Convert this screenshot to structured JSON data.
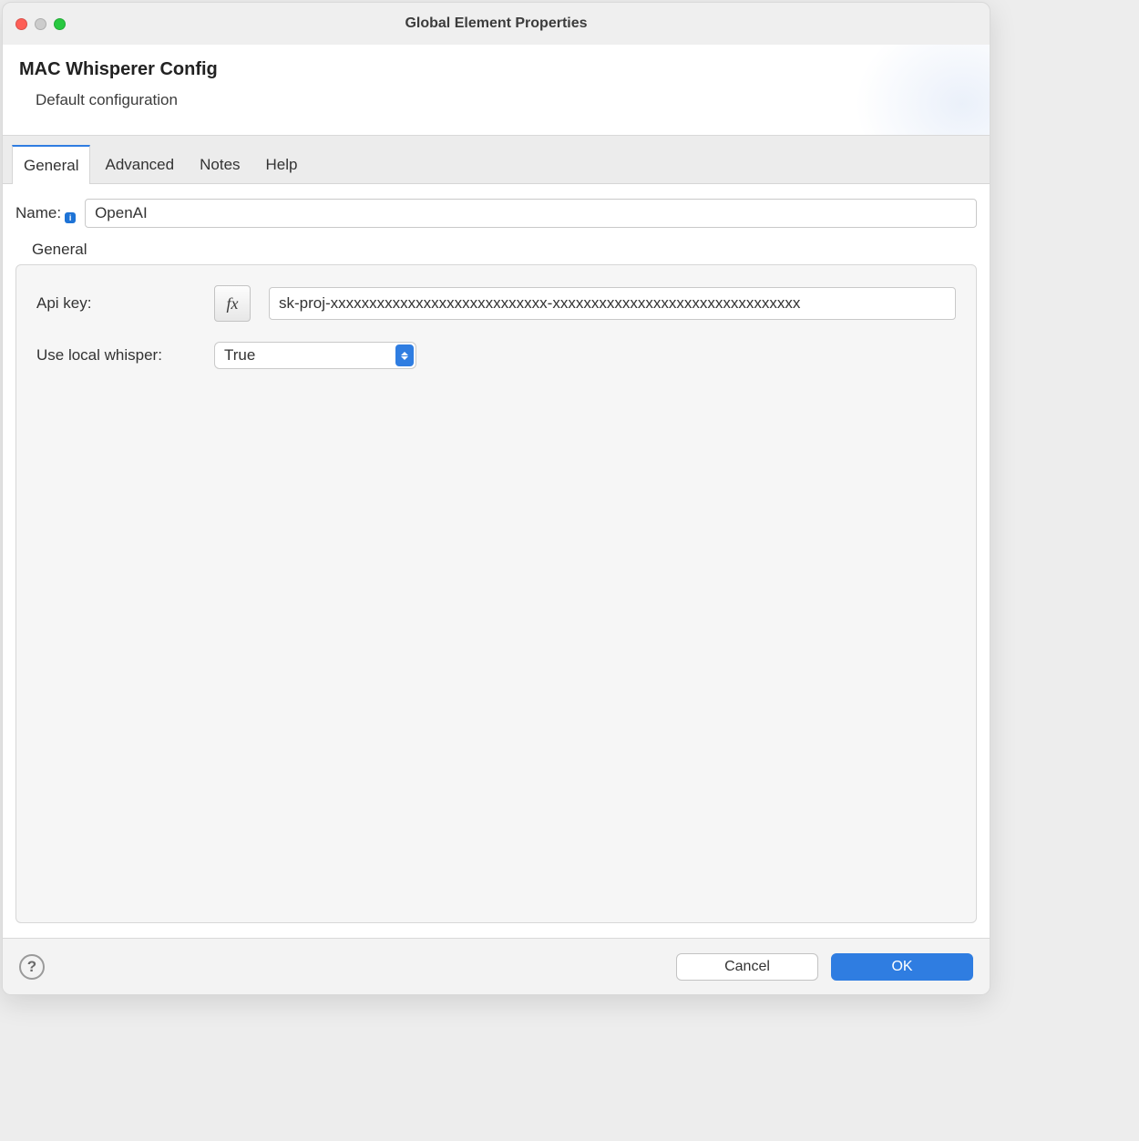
{
  "window": {
    "title": "Global Element Properties"
  },
  "header": {
    "title": "MAC Whisperer Config",
    "subtitle": "Default configuration"
  },
  "tabs": [
    {
      "label": "General",
      "active": true
    },
    {
      "label": "Advanced",
      "active": false
    },
    {
      "label": "Notes",
      "active": false
    },
    {
      "label": "Help",
      "active": false
    }
  ],
  "form": {
    "name_label": "Name:",
    "name_value": "OpenAI",
    "section_label": "General",
    "apikey_label": "Api key:",
    "fx_label": "fx",
    "apikey_value": "sk-proj-xxxxxxxxxxxxxxxxxxxxxxxxxxxx-xxxxxxxxxxxxxxxxxxxxxxxxxxxxxxxx",
    "local_label": "Use local whisper:",
    "local_value": "True"
  },
  "footer": {
    "help_label": "?",
    "cancel_label": "Cancel",
    "ok_label": "OK"
  },
  "info_icon_char": "i"
}
